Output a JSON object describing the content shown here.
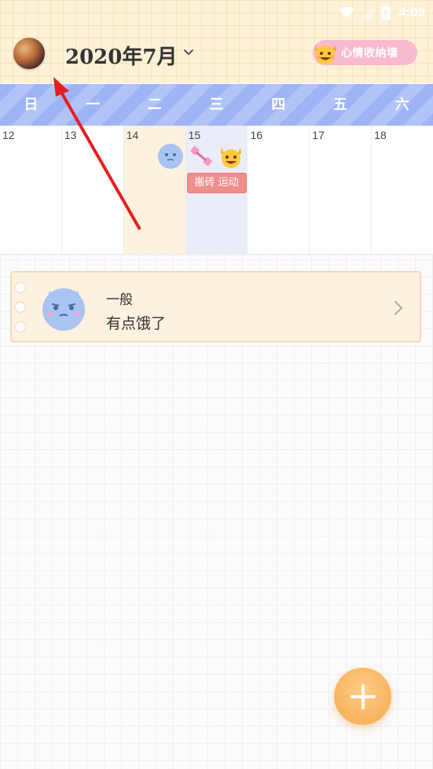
{
  "status_bar": {
    "time": "4:09"
  },
  "header": {
    "title": "2020年7月",
    "mood_wall_label": "心情收纳墙"
  },
  "weekdays": [
    "日",
    "一",
    "二",
    "三",
    "四",
    "五",
    "六"
  ],
  "days": [
    {
      "num": "12"
    },
    {
      "num": "13"
    },
    {
      "num": "14"
    },
    {
      "num": "15",
      "tag": "搬砖 运动"
    },
    {
      "num": "16"
    },
    {
      "num": "17"
    },
    {
      "num": "18"
    }
  ],
  "entry": {
    "mood": "一般",
    "note": "有点饿了"
  },
  "colors": {
    "header_bg": "#fdf1d6",
    "week_bar": "#9fb4f5",
    "accent_orange": "#f5a94f",
    "tag_red": "#f08d8d",
    "mood_wall_pink": "#f9b9cf"
  }
}
